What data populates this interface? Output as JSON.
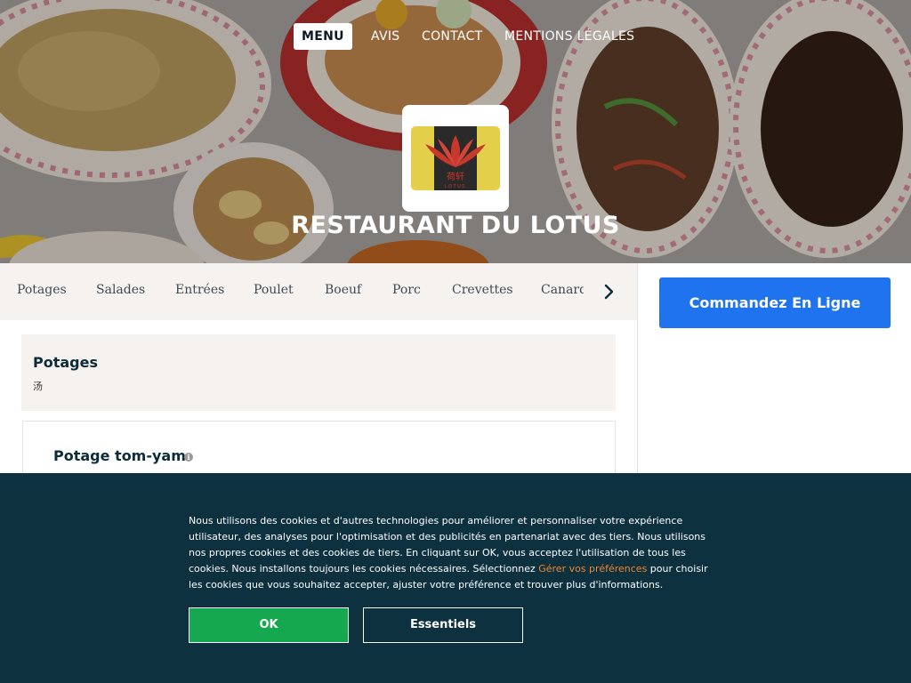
{
  "nav": {
    "items": [
      {
        "label": "MENU",
        "active": true
      },
      {
        "label": "AVIS",
        "active": false
      },
      {
        "label": "CONTACT",
        "active": false
      },
      {
        "label": "MENTIONS LÉGALES",
        "active": false
      }
    ]
  },
  "hero": {
    "logo_chinese": "荷轩",
    "logo_latin": "LOTUS",
    "title": "RESTAURANT DU LOTUS"
  },
  "categories": {
    "items": [
      "Potages",
      "Salades",
      "Entrées",
      "Poulet",
      "Boeuf",
      "Porc",
      "Crevettes",
      "Canard"
    ],
    "next_icon": "chevron-right-icon"
  },
  "order": {
    "button_label": "Commandez En Ligne"
  },
  "menu": {
    "section_title": "Potages",
    "section_subtitle": "汤",
    "first_item": {
      "name": "Potage tom-yam",
      "info_icon": "info-icon"
    }
  },
  "cookie": {
    "text_before_link": "Nous utilisons des cookies et d'autres technologies pour améliorer et personnaliser votre expérience utilisateur, des analyses pour l'optimisation et des publicités en partenariat avec des tiers. Nous utilisons nos propres cookies et des cookies de tiers. En cliquant sur OK, vous acceptez l'utilisation de tous les cookies. Nous installons toujours les cookies nécessaires. Sélectionnez ",
    "link_text": "Gérer vos préférences",
    "text_after_link": " pour choisir les cookies que vous souhaitez accepter, ajuster votre préférence et trouver plus d'informations.",
    "ok_label": "OK",
    "essential_label": "Essentiels"
  },
  "colors": {
    "accent_blue": "#1f73ee",
    "cookie_bg": "#0e3140",
    "ok_green": "#16a84f",
    "link_orange": "#f0862b",
    "logo_yellow": "#e3cf4a",
    "logo_red": "#c8392b"
  }
}
